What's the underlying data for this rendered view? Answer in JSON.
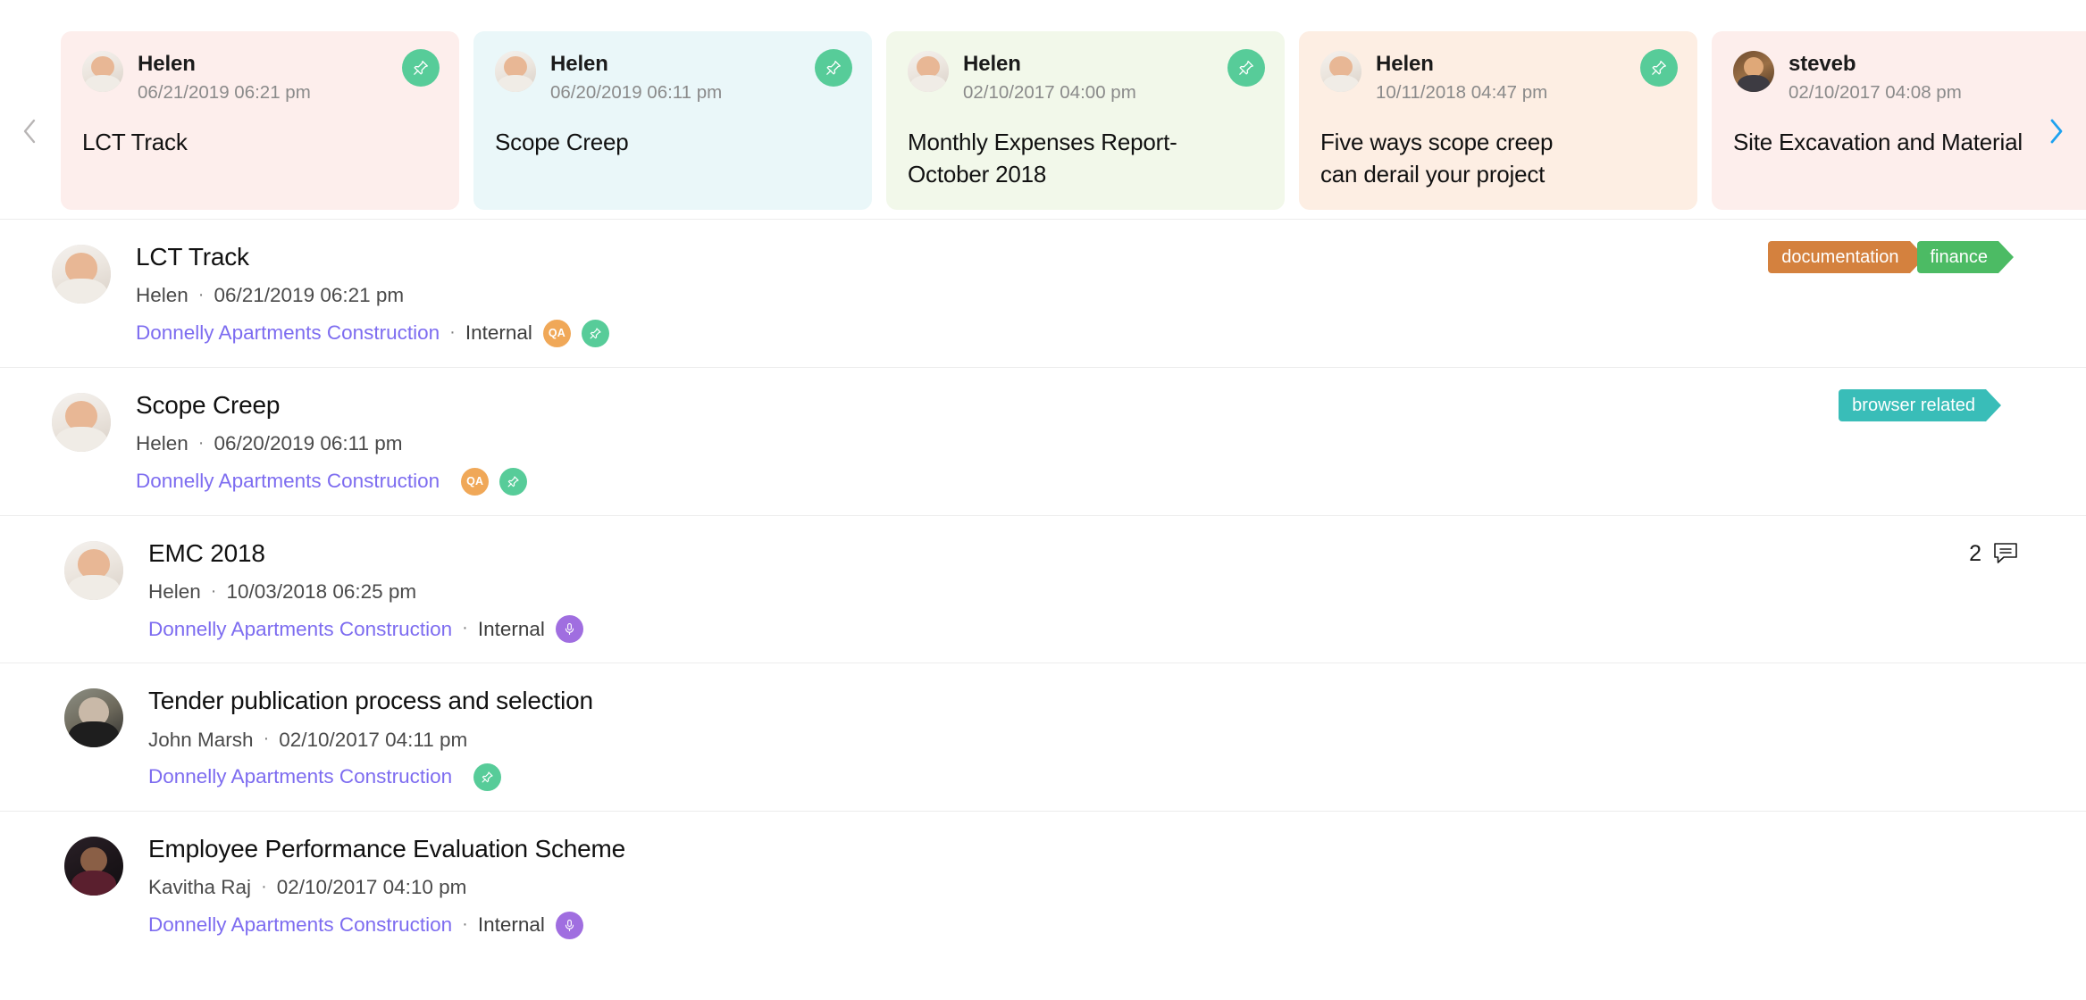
{
  "carousel": {
    "prev_label": "‹",
    "next_label": "›",
    "cards": [
      {
        "author": "Helen",
        "date": "06/21/2019 06:21 pm",
        "title": "LCT Track",
        "bg": "#fdeeec",
        "badge_icon": "pin-icon",
        "badge_color": "#57cc99",
        "avatar": "helen"
      },
      {
        "author": "Helen",
        "date": "06/20/2019 06:11 pm",
        "title": "Scope Creep",
        "bg": "#eaf7f9",
        "badge_icon": "pin-icon",
        "badge_color": "#57cc99",
        "avatar": "helen"
      },
      {
        "author": "Helen",
        "date": "02/10/2017 04:00 pm",
        "title": "Monthly Expenses Report-\nOctober 2018",
        "bg": "#f2f8ea",
        "badge_icon": "pin-icon",
        "badge_color": "#57cc99",
        "avatar": "helen"
      },
      {
        "author": "Helen",
        "date": "10/11/2018 04:47 pm",
        "title": "Five ways scope creep\ncan derail  your project",
        "bg": "#fdeee3",
        "badge_icon": "pin-icon",
        "badge_color": "#57cc99",
        "avatar": "helen"
      },
      {
        "author": "steveb",
        "date": "02/10/2017 04:08 pm",
        "title": "Site Excavation and Material",
        "bg": "#fdeeec",
        "badge_icon": "pin-icon",
        "badge_color": "#57cc99",
        "avatar": "steve"
      }
    ]
  },
  "separator": "·",
  "list": {
    "rows": [
      {
        "title": "LCT Track",
        "author": "Helen",
        "date": "06/21/2019 06:21 pm",
        "project": "Donnelly Apartments Construction",
        "visibility": "Internal",
        "avatar": "helen",
        "badges": [
          "qa",
          "pin"
        ],
        "tags": [
          {
            "label": "documentation",
            "color": "#d4813e",
            "class": "documentation"
          },
          {
            "label": "finance",
            "color": "#4cbb64",
            "class": "finance"
          }
        ],
        "comments": null
      },
      {
        "title": "Scope Creep",
        "author": "Helen",
        "date": "06/20/2019 06:11 pm",
        "project": "Donnelly Apartments Construction",
        "visibility": null,
        "avatar": "helen",
        "badges": [
          "qa",
          "pin"
        ],
        "tags": [
          {
            "label": "browser related",
            "color": "#39bdb8",
            "class": "browser"
          }
        ],
        "comments": null
      },
      {
        "title": "EMC 2018",
        "author": "Helen",
        "date": "10/03/2018 06:25 pm",
        "project": "Donnelly Apartments Construction",
        "visibility": "Internal",
        "avatar": "helen",
        "badges": [
          "mic"
        ],
        "tags": [],
        "comments": "2"
      },
      {
        "title": "Tender publication process and selection",
        "author": "John Marsh",
        "date": "02/10/2017 04:11 pm",
        "project": "Donnelly Apartments Construction",
        "visibility": null,
        "avatar": "john",
        "badges": [
          "pin"
        ],
        "tags": [],
        "comments": null
      },
      {
        "title": "Employee Performance Evaluation Scheme",
        "author": "Kavitha Raj",
        "date": "02/10/2017 04:10 pm",
        "project": "Donnelly Apartments Construction",
        "visibility": "Internal",
        "avatar": "kavitha",
        "badges": [
          "mic"
        ],
        "tags": [],
        "comments": null
      }
    ],
    "qa_label": "QA"
  }
}
